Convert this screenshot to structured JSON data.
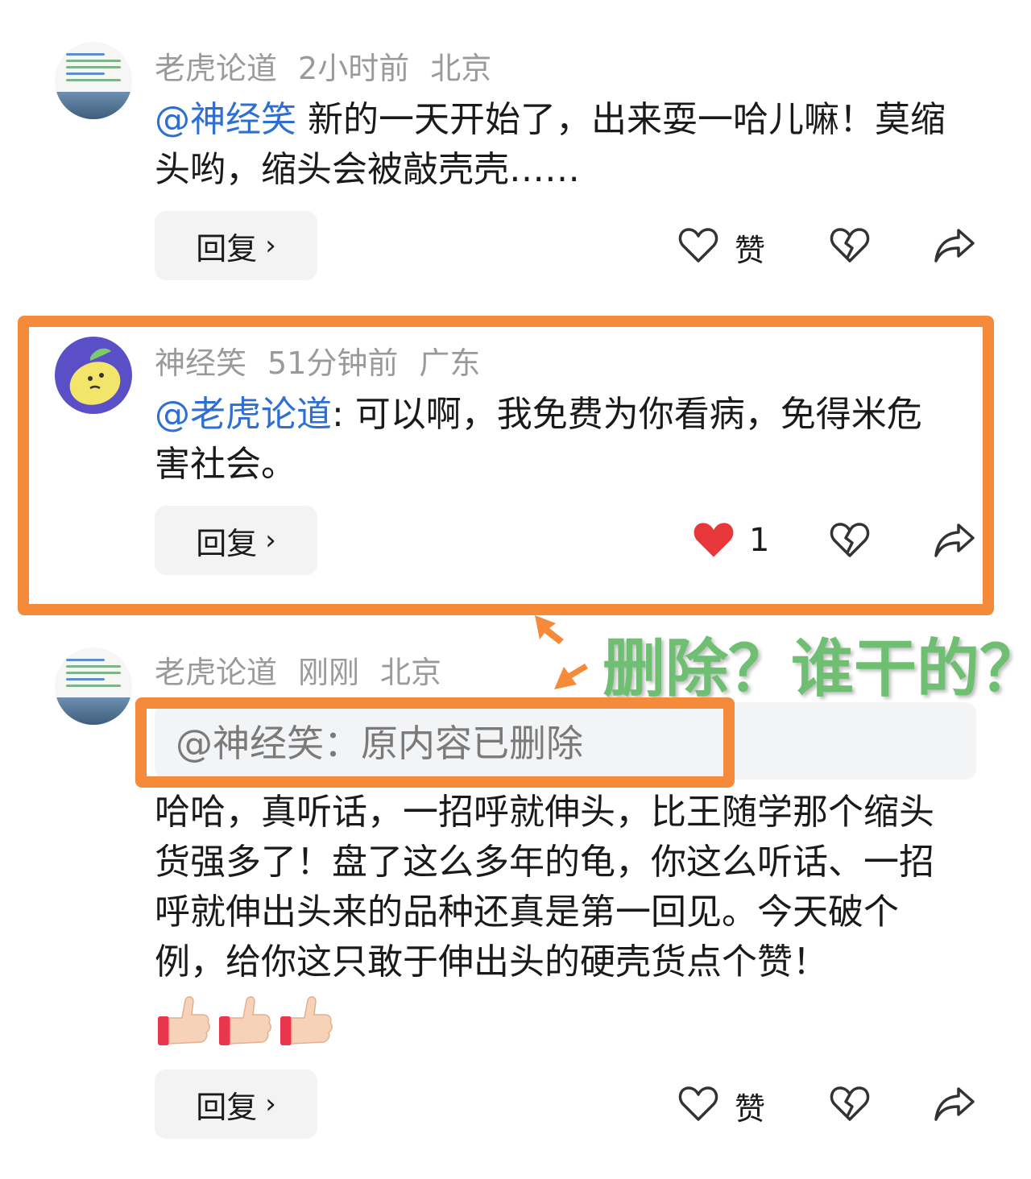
{
  "comments": [
    {
      "user": "老虎论道",
      "time": "2小时前",
      "location": "北京",
      "mention": "@神经笑",
      "body": " 新的一天开始了，出来耍一哈儿嘛！莫缩头哟，缩头会被敲壳壳……",
      "reply_label": "回复",
      "like_label": "赞"
    },
    {
      "user": "神经笑",
      "time": "51分钟前",
      "location": "广东",
      "mention": "@老虎论道",
      "body": ": 可以啊，我免费为你看病，免得米危害社会。",
      "reply_label": "回复",
      "like_count": "1",
      "liked": true
    },
    {
      "user": "老虎论道",
      "time": "刚刚",
      "location": "北京",
      "quote": "@神经笑：原内容已删除",
      "body": "哈哈，真听话，一招呼就伸头，比王随学那个缩头货强多了！盘了这么多年的龟，你这么听话、一招呼就伸出头来的品种还真是第一回见。今天破个例，给你这只敢于伸出头的硬壳货点个赞！",
      "emojis": [
        "thumbs-up",
        "thumbs-up",
        "thumbs-up"
      ],
      "reply_label": "回复",
      "like_label": "赞"
    }
  ],
  "annotation": {
    "text": "删除？谁干的？",
    "color": "#6fbf73",
    "frame_color": "#f58a3a"
  },
  "colors": {
    "mention": "#2f6fd1",
    "like_active": "#e8373a"
  }
}
